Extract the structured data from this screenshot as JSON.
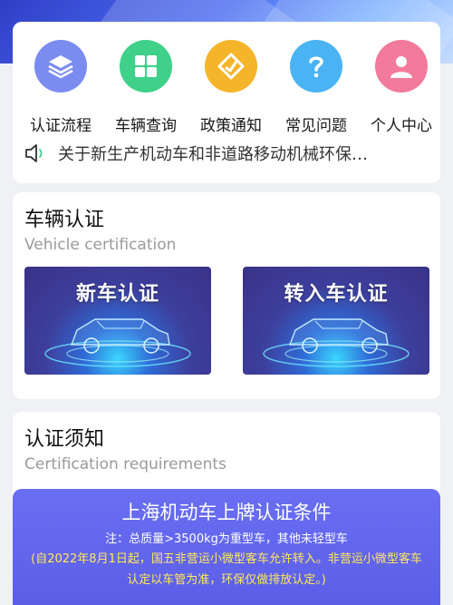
{
  "nav": {
    "items": [
      {
        "label": "认证流程",
        "icon": "layers-icon",
        "color": "#7b8cf0"
      },
      {
        "label": "车辆查询",
        "icon": "grid-icon",
        "color": "#3fd08a"
      },
      {
        "label": "政策通知",
        "icon": "diamond-icon",
        "color": "#f5b52b"
      },
      {
        "label": "常见问题",
        "icon": "question-icon",
        "color": "#4ab3f4"
      },
      {
        "label": "个人中心",
        "icon": "person-icon",
        "color": "#f27a9b"
      }
    ]
  },
  "notice": {
    "icon": "speaker-icon",
    "text": "关于新生产机动车和非道路移动机械环保…"
  },
  "vehicle_cert": {
    "title": "车辆认证",
    "subtitle": "Vehicle certification",
    "tiles": [
      {
        "label": "新车认证"
      },
      {
        "label": "转入车认证"
      }
    ]
  },
  "requirements": {
    "title": "认证须知",
    "subtitle": "Certification requirements",
    "banner_title": "上海机动车上牌认证条件",
    "banner_note": "注：总质量>3500kg为重型车，其他未轻型车",
    "banner_policy": "(自2022年8月1日起，国五非营运小微型客车允许转入。非营运小微型客车认定以车管为准，环保仅做排放认定。)"
  },
  "colors": {
    "accent": "#5b5fe8",
    "policy_text": "#ffe85a"
  }
}
